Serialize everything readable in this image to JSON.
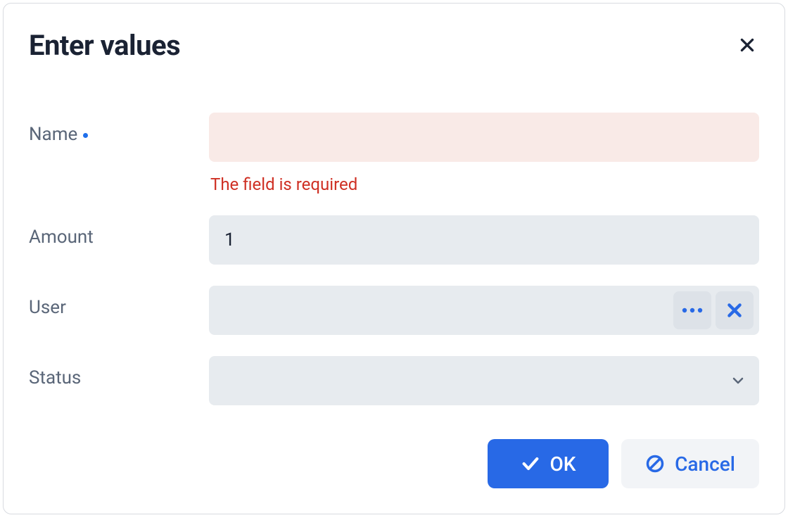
{
  "dialog": {
    "title": "Enter values",
    "fields": {
      "name": {
        "label": "Name",
        "value": "",
        "required": true,
        "error": "The field is required"
      },
      "amount": {
        "label": "Amount",
        "value": "1"
      },
      "user": {
        "label": "User",
        "value": ""
      },
      "status": {
        "label": "Status",
        "value": ""
      }
    },
    "buttons": {
      "ok": "OK",
      "cancel": "Cancel"
    }
  }
}
